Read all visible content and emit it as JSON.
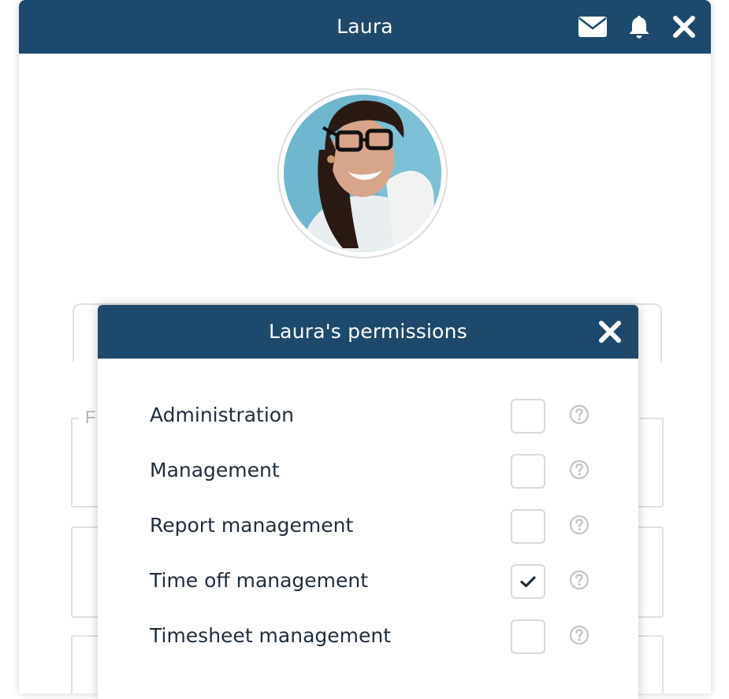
{
  "profile": {
    "title": "Laura",
    "header_icons": [
      "envelope-icon",
      "bell-icon",
      "close-icon"
    ],
    "avatar_alt": "Laura"
  },
  "background_form": {
    "first_field_label": "F"
  },
  "permissions_modal": {
    "title": "Laura's permissions",
    "items": [
      {
        "label": "Administration",
        "checked": false
      },
      {
        "label": "Management",
        "checked": false
      },
      {
        "label": "Report management",
        "checked": false
      },
      {
        "label": "Time off management",
        "checked": true
      },
      {
        "label": "Timesheet management",
        "checked": false
      }
    ]
  },
  "colors": {
    "header_bg": "#1d4a6c",
    "header_text": "#ffffff",
    "label_text": "#1f2d3d",
    "checkbox_border": "#d9d9d9",
    "help_icon": "#c8c8c8"
  }
}
